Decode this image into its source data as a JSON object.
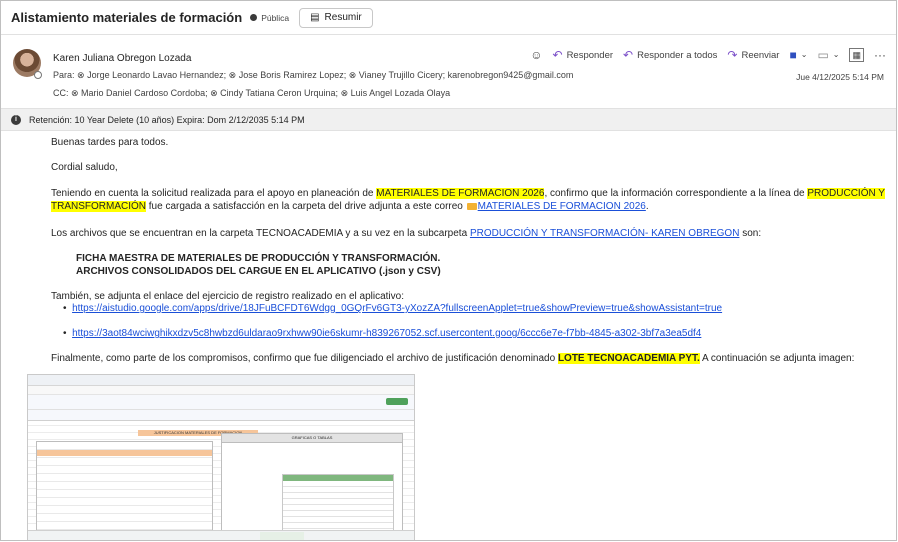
{
  "subject": "Alistamiento materiales de formación",
  "visibility_badge": "Pública",
  "summarize_button": "Resumir",
  "sender": "Karen Juliana Obregon Lozada",
  "to_label": "Para:",
  "to_recipients": "⊗ Jorge Leonardo Lavao Hernandez;  ⊗ Jose Boris Ramirez Lopez;  ⊗ Vianey Trujillo Cicery;   karenobregon9425@gmail.com",
  "cc_label": "CC:",
  "cc_recipients": "⊗ Mario Daniel Cardoso Cordoba;  ⊗ Cindy Tatiana Ceron Urquina;  ⊗ Luis Angel Lozada Olaya",
  "actions": {
    "reply": "Responder",
    "reply_all": "Responder a todos",
    "forward": "Reenviar"
  },
  "date": "Jue 4/12/2025 5:14 PM",
  "retention": "Retención: 10 Year Delete (10 años) Expira: Dom 2/12/2035 5:14 PM",
  "body": {
    "greeting": "Buenas tardes para todos.",
    "salutation": "Cordial saludo,",
    "p1_a": "Teniendo en cuenta la solicitud realizada para el apoyo en planeación de ",
    "p1_hl1": "MATERIALES DE FORMACION 2026",
    "p1_b": ", confirmo que la información correspondiente a la línea de ",
    "p1_hl2": "PRODUCCIÓN Y",
    "p1_hl3": "TRANSFORMACIÓN",
    "p1_c": " fue cargada a satisfacción en la carpeta del drive adjunta a este correo ",
    "p1_link": "MATERIALES DE FORMACION 2026",
    "p1_d": ".",
    "p2_a": "Los archivos que se encuentran en la carpeta TECNOACADEMIA y a su vez en la subcarpeta ",
    "p2_link": "PRODUCCIÓN Y TRANSFORMACIÓN- KAREN OBREGON",
    "p2_b": " son:",
    "file1": "FICHA MAESTRA DE MATERIALES DE PRODUCCIÓN Y TRANSFORMACIÓN.",
    "file2": "ARCHIVOS CONSOLIDADOS DEL CARGUE EN EL APLICATIVO (.json y CSV)",
    "p3": "También, se adjunta el enlace del ejercicio de registro realizado en el aplicativo:",
    "link1": "https://aistudio.google.com/apps/drive/18JFuBCFDT6Wdgg_0GQrFv6GT3-yXozZA?fullscreenApplet=true&showPreview=true&showAssistant=true",
    "link2": "https://3aot84wciwghikxdzv5c8hwbzd6uldarao9rxhww90ie6skumr-h839267052.scf.usercontent.goog/6ccc6e7e-f7bb-4845-a302-3bf7a3ea5df4",
    "p4_a": "Finalmente, como parte de los compromisos, confirmo que fue diligenciado el archivo de justificación denominado ",
    "p4_hl": "LOTE TECNOACADEMIA PYT.",
    "p4_b": " A continuación se adjunta imagen:"
  },
  "embedded_image": {
    "sheet_title": "JUSTIFICACION MATERIALES DE FORMACION",
    "right_header": "GRAFICAS O TABLAS"
  }
}
